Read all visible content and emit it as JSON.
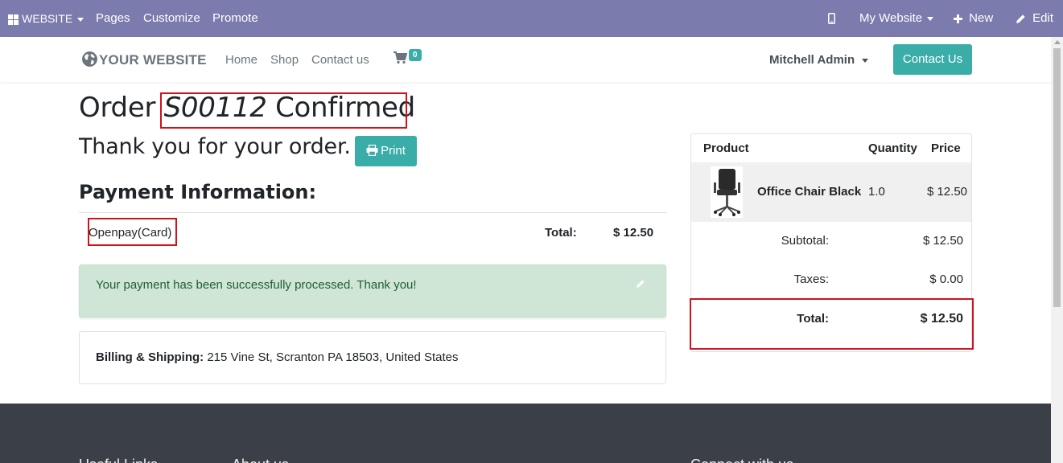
{
  "editbar": {
    "website_menu": "WEBSITE",
    "pages": "Pages",
    "customize": "Customize",
    "promote": "Promote",
    "my_website": "My Website",
    "new": "New",
    "edit": "Edit",
    "bg_color": "#7c7bad"
  },
  "site": {
    "logo_text": "YOUR WEBSITE",
    "nav": [
      "Home",
      "Shop",
      "Contact us"
    ],
    "cart_count": "0",
    "user": "Mitchell Admin",
    "contact_button": "Contact Us",
    "accent_color": "#3aada8"
  },
  "order": {
    "title_prefix": "Order",
    "order_number": "S00112",
    "title_suffix": "Confirmed",
    "thanks": "Thank you for your order.",
    "print_button": "Print"
  },
  "payment": {
    "heading": "Payment Information:",
    "method": "Openpay(Card)",
    "total_label": "Total:",
    "total_value": "$ 12.50",
    "success_message": "Your payment has been successfully processed. Thank you!"
  },
  "billing": {
    "label": "Billing & Shipping:",
    "address": "215 Vine St, Scranton PA 18503, United States"
  },
  "summary": {
    "headers": {
      "product": "Product",
      "quantity": "Quantity",
      "price": "Price"
    },
    "items": [
      {
        "name": "Office Chair Black",
        "quantity": "1.0",
        "price": "$ 12.50"
      }
    ],
    "subtotal_label": "Subtotal:",
    "subtotal_value": "$ 12.50",
    "taxes_label": "Taxes:",
    "taxes_value": "$ 0.00",
    "total_label": "Total:",
    "total_value": "$ 12.50"
  },
  "footer": {
    "headings": [
      "Useful Links",
      "About us",
      "Connect with us"
    ]
  },
  "highlight_color": "#d0131b"
}
